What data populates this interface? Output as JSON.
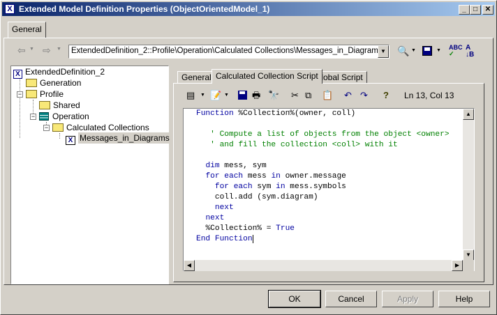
{
  "window": {
    "title": "Extended Model Definition Properties (ObjectOrientedModel_1)",
    "icon": "x-logo-icon"
  },
  "title_buttons": {
    "minimize": "_",
    "maximize": "□",
    "close": "✕"
  },
  "top_tabs": [
    {
      "label": "General"
    }
  ],
  "nav": {
    "back": "⇦",
    "forward": "⇨",
    "path": "ExtendedDefinition_2::Profile\\Operation\\Calculated Collections\\Messages_in_Diagrams"
  },
  "tree": {
    "root": "ExtendedDefinition_2",
    "generation": "Generation",
    "profile": "Profile",
    "shared": "Shared",
    "operation": "Operation",
    "calculated": "Calculated Collections",
    "messages": "Messages_in_Diagrams"
  },
  "inner_tabs": [
    {
      "label": "General"
    },
    {
      "label": "Calculated Collection Script"
    },
    {
      "label": "Global Script"
    }
  ],
  "editor_toolbar": {
    "status": "Ln 13, Col 13",
    "help": "?"
  },
  "code": {
    "l1": [
      "Function",
      " %Collection%(owner, coll)"
    ],
    "l3": "' Compute a list of objects from the object <owner>",
    "l4": "' and fill the collection <coll> with it",
    "l6": [
      "dim",
      " mess, sym"
    ],
    "l7": [
      "for each",
      " mess ",
      "in",
      " owner.message"
    ],
    "l8": [
      "for each",
      " sym ",
      "in",
      " mess.symbols"
    ],
    "l9": "coll.add (sym.diagram)",
    "l10": "next",
    "l11": "next",
    "l12": [
      "%Collection% = ",
      "True"
    ],
    "l13": [
      "End Function"
    ]
  },
  "buttons": {
    "ok": "OK",
    "cancel": "Cancel",
    "apply": "Apply",
    "help": "Help"
  },
  "colors": {
    "keyword": "#0000a0",
    "comment": "#008000",
    "titlebar": "#0a246a"
  }
}
